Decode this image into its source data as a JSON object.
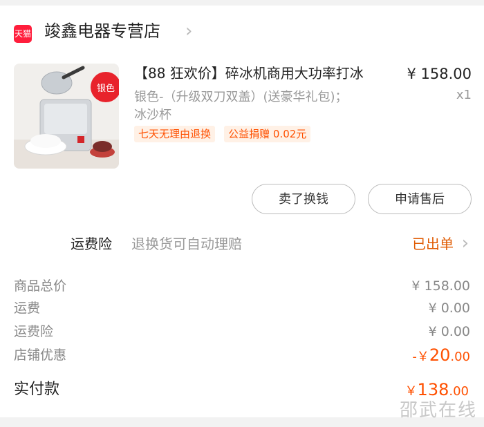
{
  "store": {
    "badge": "天猫",
    "name": "竣鑫电器专营店",
    "chevron": "›"
  },
  "product": {
    "image_label": "银色",
    "title": "【88 狂欢价】碎冰机商用大功率打冰",
    "price": "¥ 158.00",
    "quantity": "x1",
    "sku_line1": "银色-（升级双刀双盖）(送豪华礼包)；",
    "sku_line2": "冰沙杯",
    "tags": [
      "七天无理由退换",
      "公益捐赠 0.02元"
    ]
  },
  "actions": {
    "sell": "卖了换钱",
    "after_sales": "申请售后"
  },
  "insurance": {
    "label": "运费险",
    "description": "退换货可自动理赔",
    "status": "已出单"
  },
  "summary": {
    "items": [
      {
        "label": "商品总价",
        "value": "¥ 158.00"
      },
      {
        "label": "运费",
        "value": "¥ 0.00"
      },
      {
        "label": "运费险",
        "value": "¥ 0.00"
      }
    ],
    "discount": {
      "label": "店铺优惠",
      "prefix": "-￥",
      "main": "20",
      "decimals": ".00"
    },
    "total": {
      "label": "实付款",
      "prefix": "￥",
      "main": "138",
      "decimals": ".00"
    }
  },
  "watermark": "邵武在线",
  "colors": {
    "accent": "#ff5000",
    "tmall_red": "#ff1e3c",
    "status_orange": "#e05a00"
  }
}
